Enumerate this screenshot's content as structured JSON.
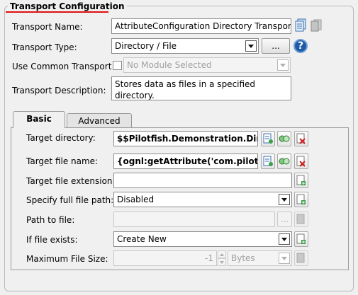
{
  "panel": {
    "title": "Transport Configuration"
  },
  "fields": {
    "transport_name": {
      "label": "Transport Name:",
      "value": "AttributeConfiguration Directory Transport"
    },
    "transport_type": {
      "label": "Transport Type:",
      "value": "Directory / File",
      "more_label": "..."
    },
    "use_common": {
      "label": "Use Common Transport",
      "value": "No Module Selected"
    },
    "description": {
      "label": "Transport Description:",
      "value": "Stores data as files in a specified directory."
    }
  },
  "tabs": [
    {
      "label": "Basic"
    },
    {
      "label": "Advanced"
    }
  ],
  "basic": {
    "target_directory": {
      "label": "Target directory:",
      "value": "$$Pilotfish.Demonstration.Director"
    },
    "target_file_name": {
      "label": "Target file name:",
      "value": "{ognl:getAttribute('com.pilotfish.Fil"
    },
    "target_file_extension": {
      "label": "Target file extension:",
      "value": ""
    },
    "full_file_path": {
      "label": "Specify full file path:",
      "value": "Disabled"
    },
    "path_to_file": {
      "label": "Path to file:",
      "value": "",
      "more_label": "..."
    },
    "if_file_exists": {
      "label": "If file exists:",
      "value": "Create New"
    },
    "max_file_size": {
      "label": "Maximum File Size:",
      "value": "-1",
      "unit": "Bytes"
    }
  },
  "help": {
    "glyph": "?"
  },
  "colors": {
    "accent_underline": "#e01010",
    "help_blue": "#1f5aa6"
  }
}
